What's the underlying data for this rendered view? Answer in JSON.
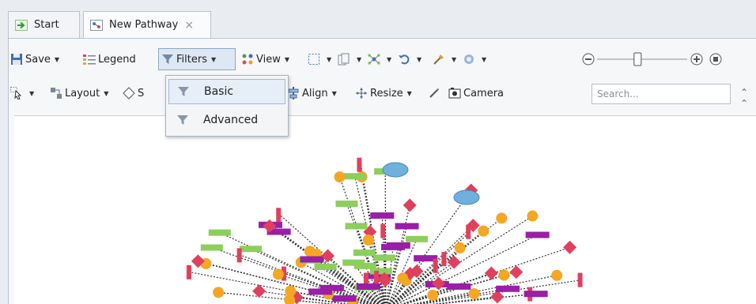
{
  "tabs": [
    {
      "label": "Start",
      "icon": "start-arrow-icon",
      "active": false
    },
    {
      "label": "New Pathway",
      "icon": "pathway-icon",
      "active": true,
      "close": "×"
    }
  ],
  "toolbar1": {
    "save_label": "Save",
    "legend_label": "Legend",
    "filters_label": "Filters",
    "view_label": "View"
  },
  "toolbar2": {
    "layout_label": "Layout",
    "style_label_fragment": "S",
    "align_label": "Align",
    "resize_label": "Resize",
    "camera_label": "Camera"
  },
  "search": {
    "placeholder": "Search..."
  },
  "filters_menu": {
    "items": [
      {
        "label": "Basic",
        "icon": "filter-icon",
        "selected": true
      },
      {
        "label": "Advanced",
        "icon": "filter-icon",
        "selected": false
      }
    ]
  },
  "zoom": {
    "level": 0.45
  },
  "colors": {
    "protein": "#9a1ea8",
    "gene": "#e0405c",
    "small_molecule": "#f5a623",
    "complex": "#6fb0dd",
    "process": "#8ccf5a",
    "accent": "#2f6fb3"
  }
}
